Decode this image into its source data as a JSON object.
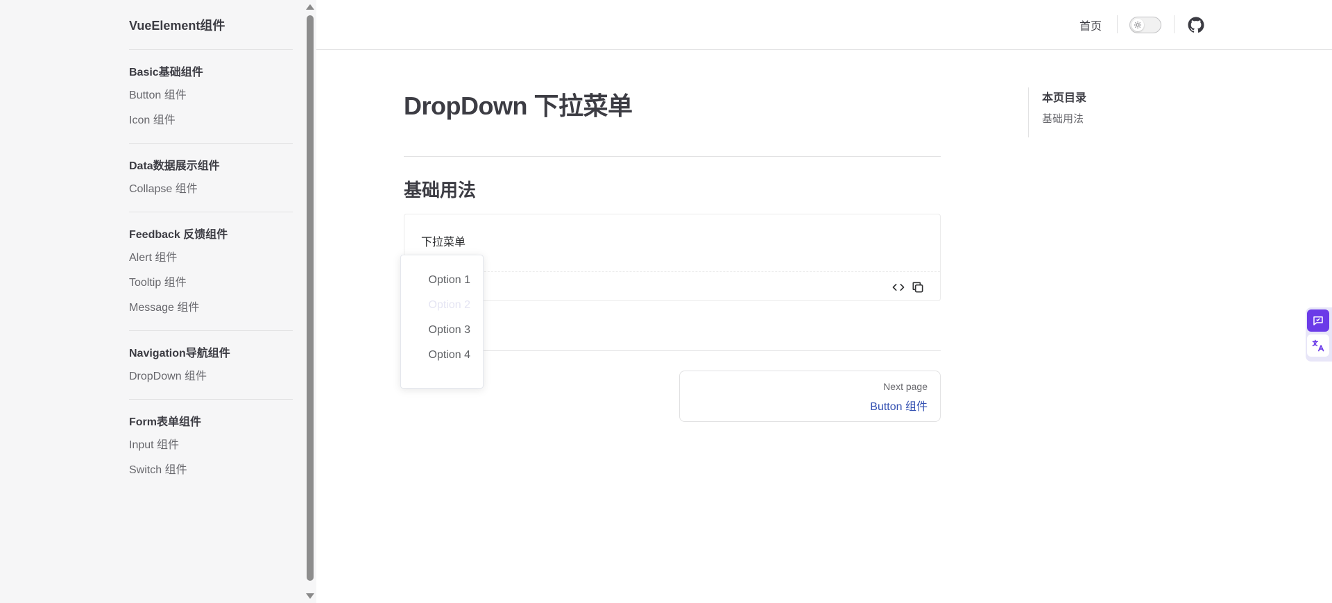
{
  "sidebar": {
    "brand": "VueElement组件",
    "groups": [
      {
        "title": "Basic基础组件",
        "items": [
          "Button 组件",
          "Icon 组件"
        ]
      },
      {
        "title": "Data数据展示组件",
        "items": [
          "Collapse 组件"
        ]
      },
      {
        "title": "Feedback 反馈组件",
        "items": [
          "Alert 组件",
          "Tooltip 组件",
          "Message 组件"
        ]
      },
      {
        "title": "Navigation导航组件",
        "items": [
          "DropDown 组件"
        ]
      },
      {
        "title": "Form表单组件",
        "items": [
          "Input 组件",
          "Switch 组件"
        ]
      }
    ]
  },
  "nav": {
    "home": "首页",
    "icons": {
      "theme_toggle": "sun-icon",
      "github": "github-icon"
    }
  },
  "main": {
    "title": "DropDown 下拉菜单",
    "section_title": "基础用法",
    "demo": {
      "trigger_label": "下拉菜单",
      "icons": {
        "code": "code-icon",
        "copy": "copy-icon"
      }
    },
    "next": {
      "label": "Next page",
      "title": "Button 组件"
    }
  },
  "dropdown": {
    "items": [
      {
        "label": "Option 1",
        "disabled": false
      },
      {
        "label": "Option 2",
        "disabled": true
      },
      {
        "label": "Option 3",
        "disabled": false
      },
      {
        "label": "Option 4",
        "disabled": false
      }
    ]
  },
  "outline": {
    "title": "本页目录",
    "links": [
      "基础用法"
    ]
  },
  "colors": {
    "accent": "#3451b2",
    "sidebar_bg": "#f6f6f7",
    "float_primary": "#6b3be8"
  }
}
